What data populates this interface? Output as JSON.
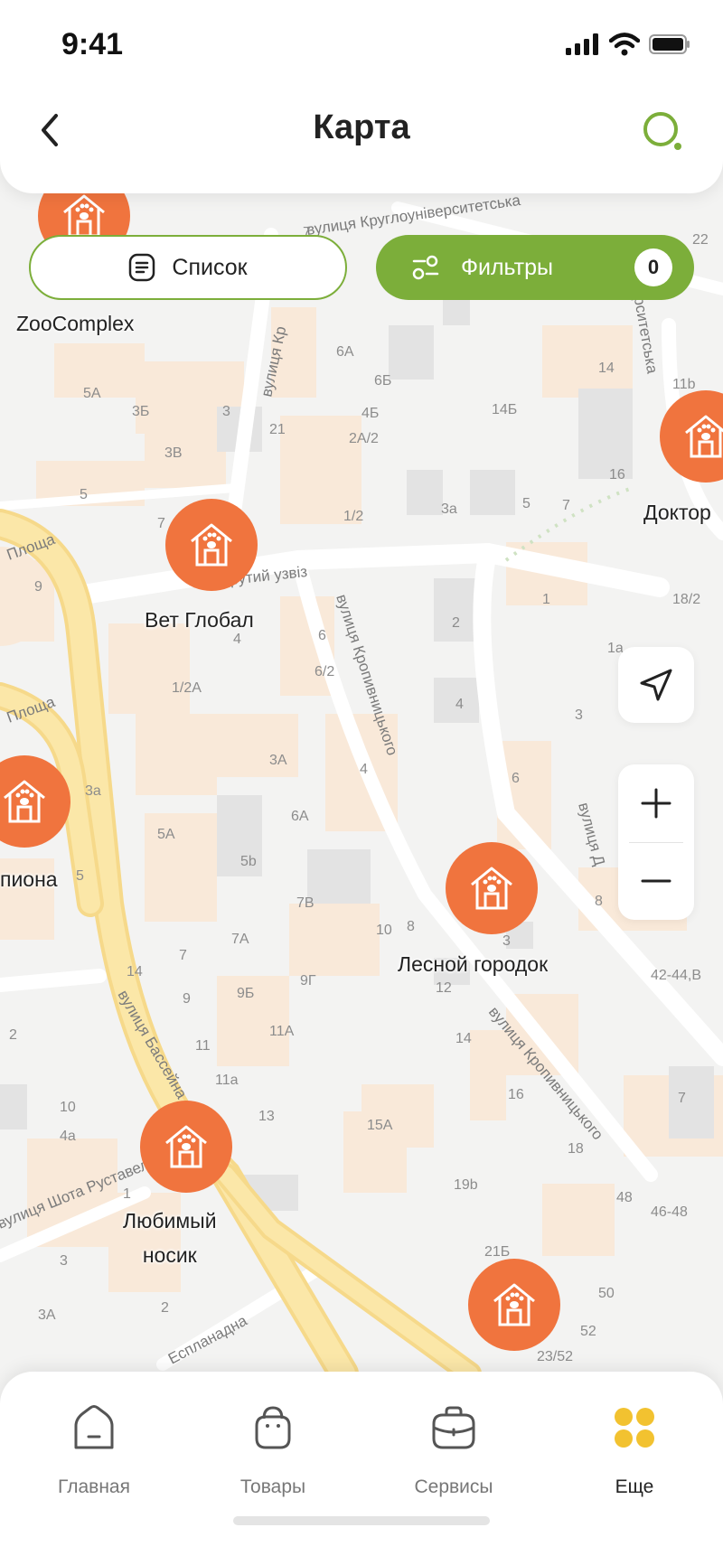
{
  "status_bar": {
    "time": "9:41"
  },
  "header": {
    "title": "Карта"
  },
  "pills": {
    "list_label": "Список",
    "filter_label": "Фильтры",
    "filter_count": "0"
  },
  "markers": [
    {
      "label": "ZooComplex"
    },
    {
      "label": "Вет Глобал"
    },
    {
      "label": "Доктор"
    },
    {
      "label": "пиона"
    },
    {
      "label": "Лесной городок"
    },
    {
      "label": "Любимый\nносик"
    },
    {
      "label": ""
    }
  ],
  "map": {
    "streets": [
      "вулиця Кропивницького",
      "вулиця Кропивницького",
      "вулиця Бассейна",
      "вулиця Шота Руставелі",
      "Еспланадна",
      "Крутий узвіз",
      "вулиця Круглоуніверситетська",
      "ерситетська",
      "вулиця Д",
      "Площа",
      "Площа"
    ],
    "buildings": [
      "7",
      "22",
      "14",
      "11b",
      "6А",
      "6Б",
      "5А",
      "3Б",
      "3",
      "4Б",
      "14Б",
      "2А/2",
      "21",
      "3В",
      "5",
      "16",
      "7",
      "5",
      "3а",
      "1/2",
      "7",
      "9",
      "6",
      "1",
      "18/2",
      "2",
      "4",
      "6/2",
      "1а",
      "1/2А",
      "4",
      "3",
      "3А",
      "6",
      "3а",
      "5А",
      "6А",
      "4",
      "5b",
      "7В",
      "8",
      "7А",
      "10",
      "8",
      "3",
      "7",
      "9Б",
      "9Г",
      "12",
      "42-44,В",
      "14",
      "9",
      "11А",
      "11",
      "2",
      "10",
      "11а",
      "4а",
      "13",
      "16",
      "7",
      "15А",
      "18",
      "19b",
      "48",
      "46-48",
      "1",
      "21Б",
      "3",
      "2",
      "50",
      "3А",
      "52",
      "23/52",
      "5"
    ]
  },
  "colors": {
    "accent": "#7cae3a",
    "marker": "#f0743e",
    "nav_active": "#f2c230"
  },
  "bottom_nav": [
    {
      "label": "Главная",
      "icon": "home-icon"
    },
    {
      "label": "Товары",
      "icon": "bag-icon"
    },
    {
      "label": "Сервисы",
      "icon": "briefcase-icon"
    },
    {
      "label": "Еще",
      "icon": "grid-icon"
    }
  ]
}
